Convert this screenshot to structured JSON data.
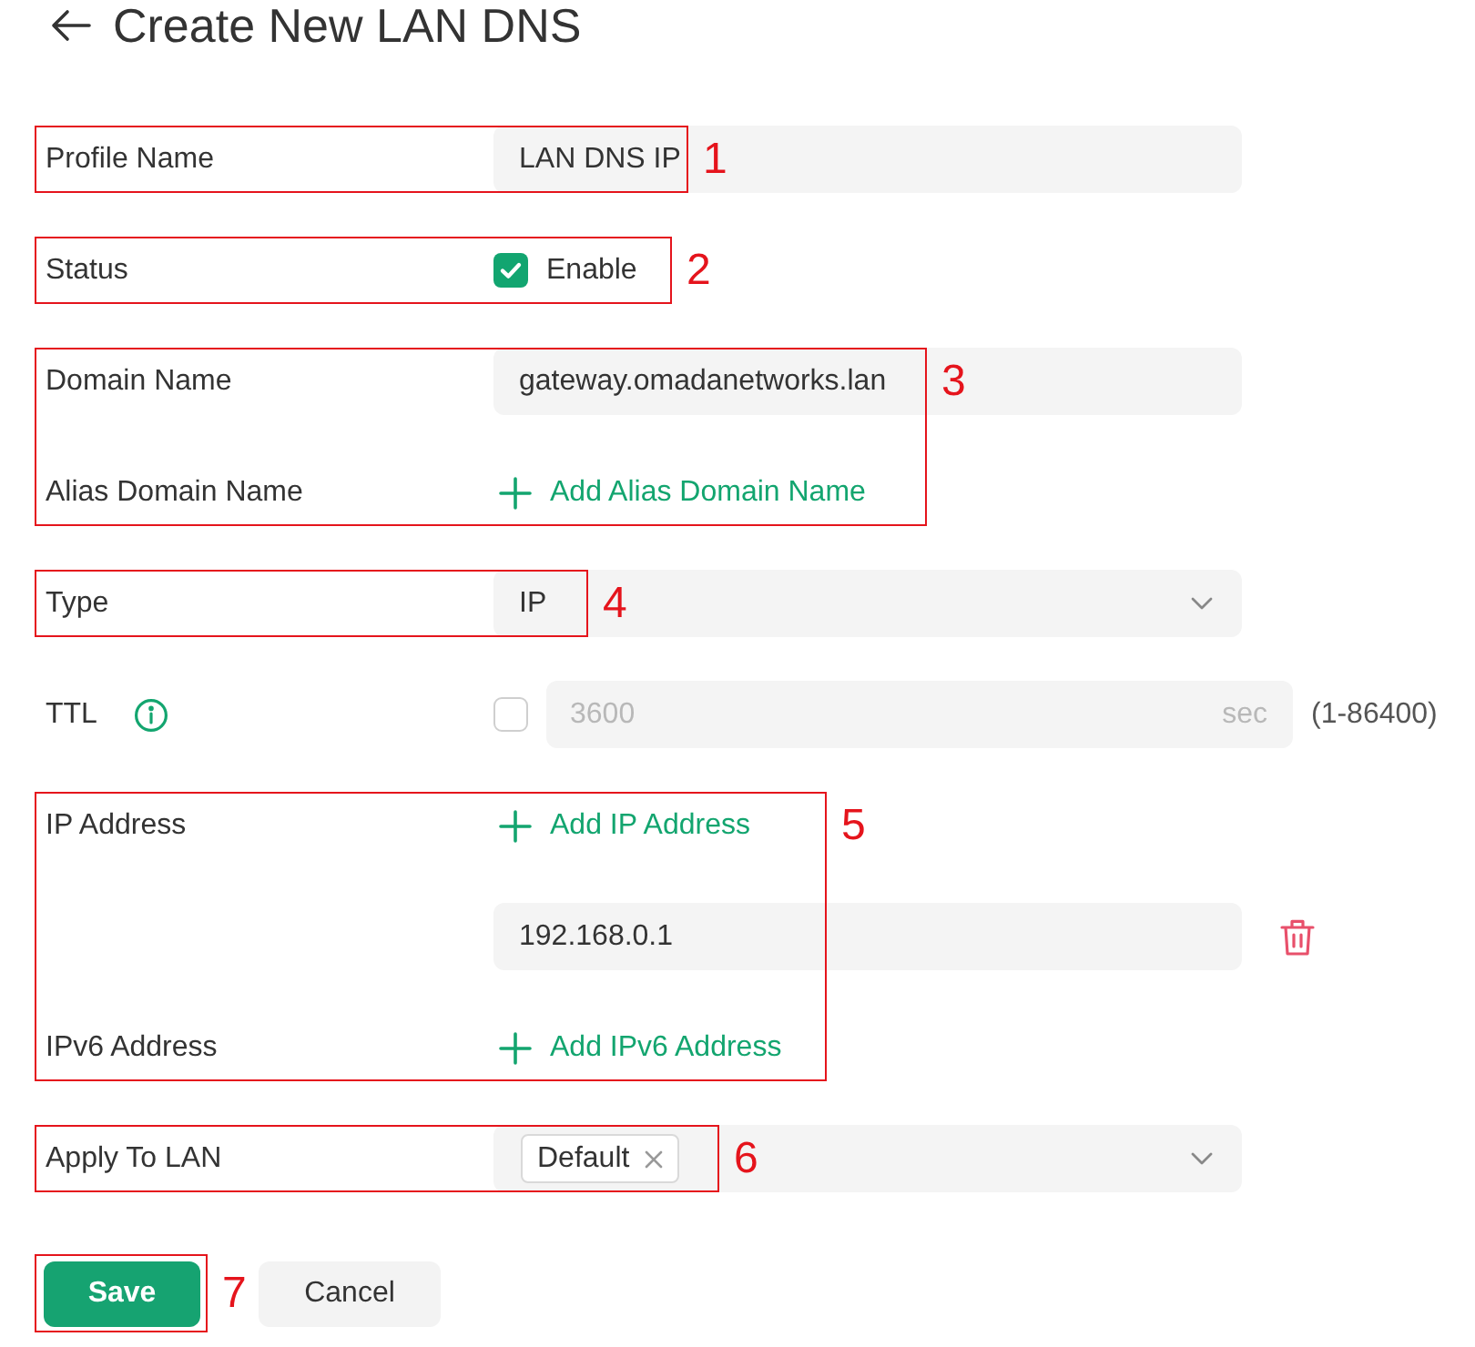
{
  "header": {
    "title": "Create New LAN DNS"
  },
  "sections": [
    {
      "annotation": "1",
      "rows": [
        {
          "kind": "input",
          "label": "Profile Name",
          "value": "LAN DNS IP"
        }
      ]
    },
    {
      "annotation": "2",
      "rows": [
        {
          "kind": "checkbox",
          "label": "Status",
          "option": "Enable",
          "checked": true
        }
      ]
    },
    {
      "annotation": "3",
      "rows": [
        {
          "kind": "input",
          "label": "Domain Name",
          "value": "gateway.omadanetworks.lan"
        },
        {
          "kind": "add",
          "label": "Alias Domain Name",
          "action": "Add Alias Domain Name"
        }
      ]
    },
    {
      "annotation": "4",
      "rows": [
        {
          "kind": "select",
          "label": "Type",
          "value": "IP"
        }
      ]
    },
    {
      "rows": [
        {
          "kind": "ttl",
          "label": "TTL",
          "checked": false,
          "value": "3600",
          "unit": "sec",
          "range": "(1-86400)"
        }
      ]
    },
    {
      "annotation": "5",
      "rows": [
        {
          "kind": "add",
          "label": "IP Address",
          "action": "Add IP Address",
          "entries": [
            "192.168.0.1"
          ]
        },
        {
          "kind": "add",
          "label": "IPv6 Address",
          "action": "Add IPv6 Address"
        }
      ]
    },
    {
      "annotation": "6",
      "rows": [
        {
          "kind": "tags",
          "label": "Apply To LAN",
          "tags": [
            "Default"
          ]
        }
      ]
    }
  ],
  "buttons": [
    {
      "kind": "primary",
      "label": "Save",
      "annotation": "7"
    },
    {
      "kind": "secondary",
      "label": "Cancel"
    }
  ]
}
